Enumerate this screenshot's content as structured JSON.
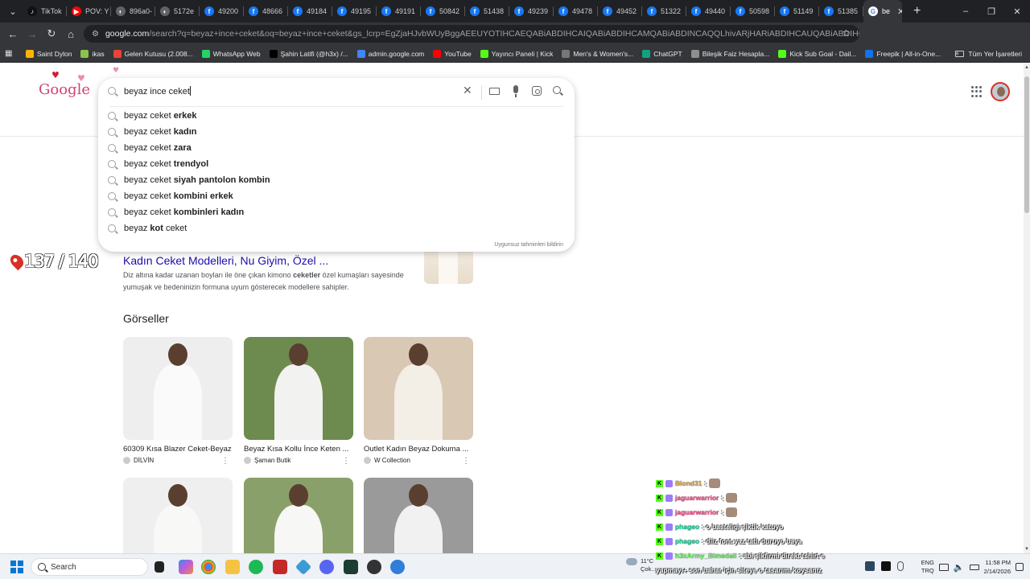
{
  "browser": {
    "tabs": [
      {
        "label": "TikTok",
        "color": "#111111",
        "glyph": "♪"
      },
      {
        "label": "POV: Y",
        "color": "#ff0000",
        "glyph": "▶"
      },
      {
        "label": "896a0-",
        "color": "#5f6368",
        "glyph": "◐"
      },
      {
        "label": "5172e",
        "color": "#5f6368",
        "glyph": "◐"
      },
      {
        "label": "49200",
        "color": "#1877f2",
        "glyph": "f"
      },
      {
        "label": "48666",
        "color": "#1877f2",
        "glyph": "f"
      },
      {
        "label": "49184",
        "color": "#1877f2",
        "glyph": "f"
      },
      {
        "label": "49195",
        "color": "#1877f2",
        "glyph": "f"
      },
      {
        "label": "49191",
        "color": "#1877f2",
        "glyph": "f"
      },
      {
        "label": "50842",
        "color": "#1877f2",
        "glyph": "f"
      },
      {
        "label": "51438",
        "color": "#1877f2",
        "glyph": "f"
      },
      {
        "label": "49239",
        "color": "#1877f2",
        "glyph": "f"
      },
      {
        "label": "49478",
        "color": "#1877f2",
        "glyph": "f"
      },
      {
        "label": "49452",
        "color": "#1877f2",
        "glyph": "f"
      },
      {
        "label": "51322",
        "color": "#1877f2",
        "glyph": "f"
      },
      {
        "label": "49440",
        "color": "#1877f2",
        "glyph": "f"
      },
      {
        "label": "50598",
        "color": "#1877f2",
        "glyph": "f"
      },
      {
        "label": "51149",
        "color": "#1877f2",
        "glyph": "f"
      },
      {
        "label": "51385",
        "color": "#1877f2",
        "glyph": "f"
      }
    ],
    "active_tab": {
      "label": "be",
      "close": "✕"
    },
    "new_tab": "+",
    "window_controls": {
      "minimize": "–",
      "maximize": "❐",
      "close": "✕"
    },
    "url_domain": "google.com",
    "url_path": "/search?q=beyaz+ince+ceket&oq=beyaz+ince+ceket&gs_lcrp=EgZjaHJvbWUyBggAEEUYOTIHCAEQABiABDIHCAIQABiABDIHCAMQABiABDINCAQQLhivARjHARiABDIHCAUQABiABDIHCAYQABiABDIHCAcQABi...",
    "nav": {
      "back": "←",
      "forward": "→",
      "reload": "↻",
      "home": "⌂",
      "star": "☆"
    },
    "bookmarks": [
      {
        "label": "Saint Dylon",
        "color": "#ffb300"
      },
      {
        "label": "ikas",
        "color": "#8bc34a"
      },
      {
        "label": "Gelen Kutusu (2.008...",
        "color": "#ea4335"
      },
      {
        "label": "WhatsApp Web",
        "color": "#25d366"
      },
      {
        "label": "Şahin Latifi (@h3x) /...",
        "color": "#000000"
      },
      {
        "label": "admin.google.com",
        "color": "#4285f4"
      },
      {
        "label": "YouTube",
        "color": "#ff0000"
      },
      {
        "label": "Yayıncı Paneli | Kick",
        "color": "#53fc18"
      },
      {
        "label": "Men's & Women's...",
        "color": "#777777"
      },
      {
        "label": "ChatGPT",
        "color": "#10a37f"
      },
      {
        "label": "Bileşik Faiz Hesapla...",
        "color": "#8e8e8e"
      },
      {
        "label": "Kick Sub Goal - Dail...",
        "color": "#53fc18"
      },
      {
        "label": "Freepik | All-in-One...",
        "color": "#1273eb"
      }
    ],
    "bookmarks_more": "»",
    "bookmarks_folder": "Tüm Yer İşaretleri"
  },
  "google": {
    "logo_text": "Google",
    "query": "beyaz ince ceket",
    "suggestions": [
      {
        "prefix": "beyaz ceket ",
        "bold": "erkek",
        "suffix": ""
      },
      {
        "prefix": "beyaz ceket ",
        "bold": "kadın",
        "suffix": ""
      },
      {
        "prefix": "beyaz ceket ",
        "bold": "zara",
        "suffix": ""
      },
      {
        "prefix": "beyaz ceket ",
        "bold": "trendyol",
        "suffix": ""
      },
      {
        "prefix": "beyaz ceket ",
        "bold": "siyah pantolon kombin",
        "suffix": ""
      },
      {
        "prefix": "beyaz ceket ",
        "bold": "kombini erkek",
        "suffix": ""
      },
      {
        "prefix": "beyaz ceket ",
        "bold": "kombinleri kadın",
        "suffix": ""
      },
      {
        "prefix": "beyaz ",
        "bold": "kot",
        "suffix": " ceket"
      }
    ],
    "report_link": "Uygunsuz tahminleri bildirin",
    "clear_icon": "✕",
    "result": {
      "title": "Kadın Ceket Modelleri, Nu Giyim, Özel ...",
      "snippet_a": "Diz altına kadar uzanan boyları ile öne çıkan kimono ",
      "snippet_b": "ceketler",
      "snippet_c": " özel kumaşları sayesinde yumuşak ve bedeninizin formuna uyum gösterecek modellere sahipler."
    },
    "images_heading": "Görseller",
    "images": [
      {
        "caption": "60309 Kısa Blazer Ceket-Beyaz",
        "source": "DİLVİN",
        "bg": "#eeeeee",
        "fig": "#fafafa"
      },
      {
        "caption": "Beyaz Kısa Kollu İnce Keten ...",
        "source": "Şaman Butik",
        "bg": "#6d8b4e",
        "fig": "#f2f2f0"
      },
      {
        "caption": "Outlet Kadın Beyaz Dokuma ...",
        "source": "W Collection",
        "bg": "#d9c8b4",
        "fig": "#f3eee6"
      },
      {
        "caption": "",
        "source": "",
        "bg": "#efefef",
        "fig": "#f8f8f6"
      },
      {
        "caption": "",
        "source": "",
        "bg": "#8aa06a",
        "fig": "#f7f7f5"
      },
      {
        "caption": "",
        "source": "",
        "bg": "#9a9a9a",
        "fig": "#f1f1f1"
      }
    ],
    "kebab": "⋮"
  },
  "overlay_counter": "137 / 140",
  "chat": [
    {
      "user": "Blond31",
      "msg": "",
      "user_style": ""
    },
    {
      "user": "jaguarwarrior",
      "msg": "",
      "user_style": "pink"
    },
    {
      "user": "jaguarwarrior",
      "msg": "",
      "user_style": "pink"
    },
    {
      "user": "phageo",
      "msg": ": o basteligi şiktik katuyo",
      "user_style": "teal"
    },
    {
      "user": "phageo",
      "msg": ": diiz font yaz tatlı duruyo baya",
      "user_style": "teal"
    },
    {
      "user": "h3xArmy_Bimedali",
      "msg": ": abi şikfirmi direkt tshirt e",
      "user_style": "green"
    }
  ],
  "chat_continued": "yapmayı+ son bahar için siteye o tasarımı koysanız",
  "taskbar": {
    "search_label": "Search",
    "weather_temp": "11°C",
    "weather_desc": "Çok...",
    "lang_top": "ENG",
    "lang_bottom": "TRQ",
    "time": "11:58 PM",
    "date": "2/14/2026"
  }
}
